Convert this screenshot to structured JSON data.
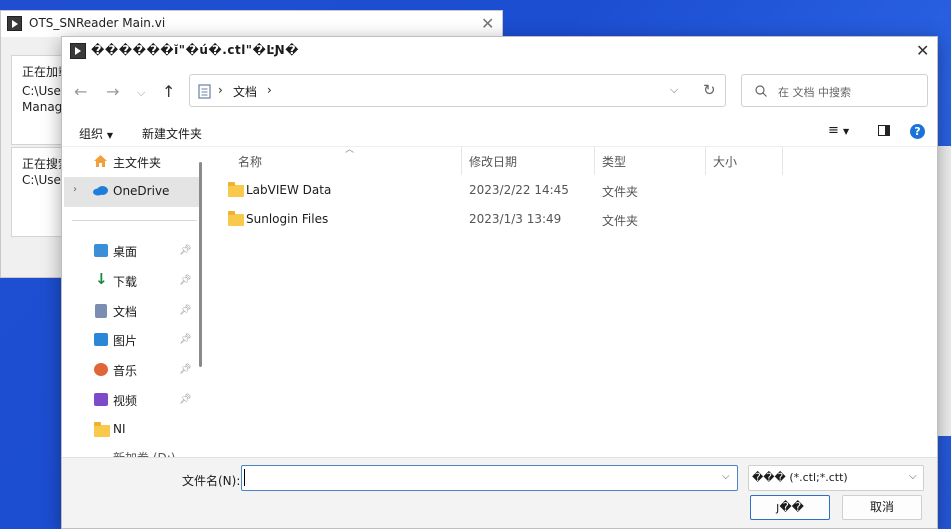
{
  "background_window": {
    "title": "OTS_SNReader Main.vi",
    "group1_line1": "正在加载",
    "group1_line2": "C:\\User",
    "group1_line3": "Manag",
    "group2_line1": "正在搜索",
    "group2_line2": "C:\\User"
  },
  "dialog": {
    "title": "������ĭ\"�ú�.ctl\"�ĿƝ�",
    "address": {
      "segment": "文档",
      "chevron": "›"
    },
    "search": {
      "placeholder": "在 文档 中搜索"
    },
    "toolbar": {
      "organize": "组织",
      "new_folder": "新建文件夹"
    },
    "nav": [
      {
        "label": "主文件夹",
        "icon": "home-icon",
        "pinned": false
      },
      {
        "label": "OneDrive",
        "icon": "cloud-icon",
        "pinned": false,
        "selected": true
      },
      {
        "label": "桌面",
        "icon": "desktop-icon",
        "pinned": true
      },
      {
        "label": "下载",
        "icon": "download-icon",
        "pinned": true
      },
      {
        "label": "文档",
        "icon": "document-icon",
        "pinned": true
      },
      {
        "label": "图片",
        "icon": "picture-icon",
        "pinned": true
      },
      {
        "label": "音乐",
        "icon": "music-icon",
        "pinned": true
      },
      {
        "label": "视频",
        "icon": "video-icon",
        "pinned": true
      },
      {
        "label": "NI",
        "icon": "folder-icon",
        "pinned": false
      },
      {
        "label": "新加卷 (D:)",
        "icon": "drive-icon",
        "pinned": false
      }
    ],
    "columns": {
      "name": "名称",
      "modified": "修改日期",
      "type": "类型",
      "size": "大小"
    },
    "files": [
      {
        "name": "LabVIEW Data",
        "modified": "2023/2/22 14:45",
        "type": "文件夹"
      },
      {
        "name": "Sunlogin Files",
        "modified": "2023/1/3 13:49",
        "type": "文件夹"
      }
    ],
    "filename_label": "文件名(N):",
    "filename_value": "",
    "filter_value": "��� (*.ctl;*.ctt)",
    "ok_label": "ȷ��",
    "cancel_label": "取消"
  },
  "colors": {
    "desktop": "#1f4fd0",
    "accent": "#2f6fc4",
    "folder": "#f8c94b"
  }
}
